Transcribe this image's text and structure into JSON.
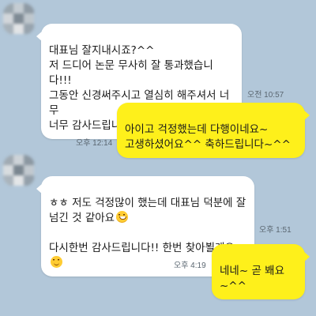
{
  "messages": [
    {
      "id": "m1",
      "direction": "incoming",
      "text": "대표님 잘지내시죠?^^\n저 드디어 논문 무사히 잘 통과했습니다!!!\n그동안 신경써주시고 열심히 해주셔서 너무\n너무 감사드립니다",
      "emoji": "smiling-face-icon",
      "time": "오전 10:57"
    },
    {
      "id": "m2",
      "direction": "outgoing",
      "text": "아이고 걱정했는데 다행이네요~\n고생하셨어요^^ 축하드립니다~^^",
      "time": "오후 12:14"
    },
    {
      "id": "m3",
      "direction": "incoming",
      "line1": "ㅎㅎ 저도 걱정많이 했는데 대표님 덕분에 잘\n넘긴 것 같아요",
      "line2": "다시한번 감사드립니다!! 한번 찾아뵐게요",
      "emoji1": "grinning-face-icon",
      "emoji2": "smiling-face-icon",
      "time": "오후 1:51"
    },
    {
      "id": "m4",
      "direction": "outgoing",
      "text": "네네~ 곧 봬요~^^",
      "time": "오후 4:19"
    }
  ],
  "colors": {
    "background": "#b2c7d9",
    "incoming_bubble": "#ffffff",
    "outgoing_bubble": "#fef01b",
    "timestamp": "#5a6670"
  }
}
